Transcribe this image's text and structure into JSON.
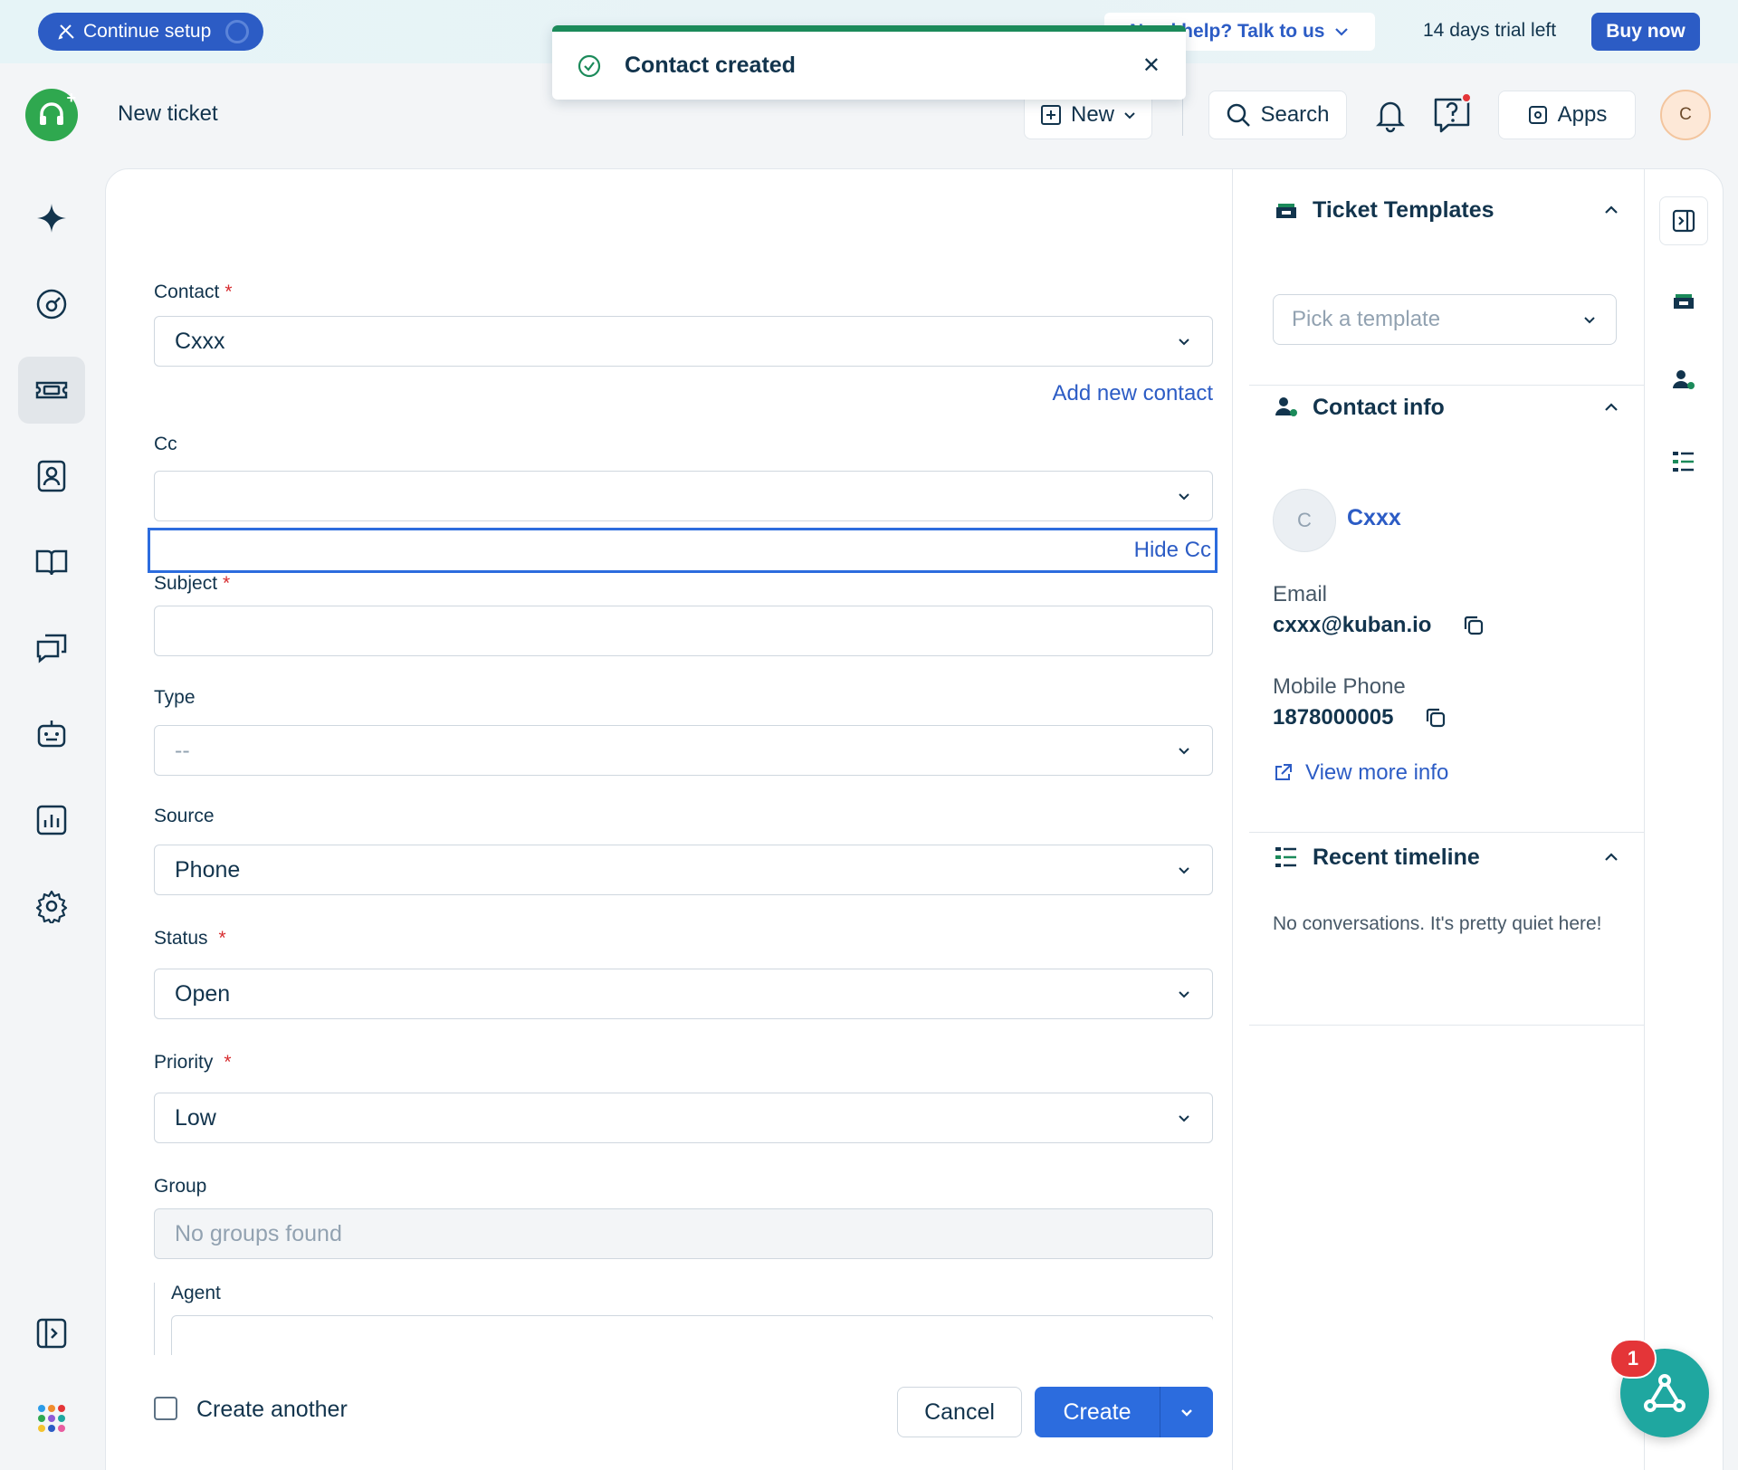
{
  "banner": {
    "setup_label": "Continue setup",
    "help_label": "Need help? Talk to us",
    "trial_text": "14 days trial left",
    "buy_label": "Buy now"
  },
  "header": {
    "title": "New ticket",
    "new_label": "New",
    "search_label": "Search",
    "apps_label": "Apps",
    "avatar_initial": "C"
  },
  "toast": {
    "message": "Contact created",
    "color": "#1b8a5a"
  },
  "nav": {
    "items": [
      "freddy-ai",
      "dashboard",
      "tickets",
      "contacts",
      "solutions",
      "conversations",
      "bots",
      "analytics",
      "admin-settings"
    ],
    "active": "tickets"
  },
  "form": {
    "contact": {
      "label": "Contact",
      "value": "Cxxx",
      "add_link": "Add new contact"
    },
    "cc": {
      "label": "Cc",
      "value": "",
      "hide_link": "Hide Cc"
    },
    "subject": {
      "label": "Subject",
      "value": ""
    },
    "type": {
      "label": "Type",
      "value": "--"
    },
    "source": {
      "label": "Source",
      "value": "Phone"
    },
    "status": {
      "label": "Status",
      "value": "Open"
    },
    "priority": {
      "label": "Priority",
      "value": "Low"
    },
    "group": {
      "label": "Group",
      "value": "No groups found"
    },
    "agent": {
      "label": "Agent"
    },
    "required_marker": "*"
  },
  "footer": {
    "create_another_label": "Create another",
    "create_another_checked": false,
    "cancel_label": "Cancel",
    "create_label": "Create"
  },
  "right_panel": {
    "templates": {
      "title": "Ticket Templates",
      "placeholder": "Pick a template"
    },
    "contact_info": {
      "title": "Contact info",
      "avatar_initial": "C",
      "name": "Cxxx",
      "email_label": "Email",
      "email": "cxxx@kuban.io",
      "phone_label": "Mobile Phone",
      "phone": "1878000005",
      "view_more": "View more info"
    },
    "timeline": {
      "title": "Recent timeline",
      "empty_text": "No conversations. It's pretty quiet here!"
    }
  },
  "widget": {
    "badge_count": "1"
  }
}
